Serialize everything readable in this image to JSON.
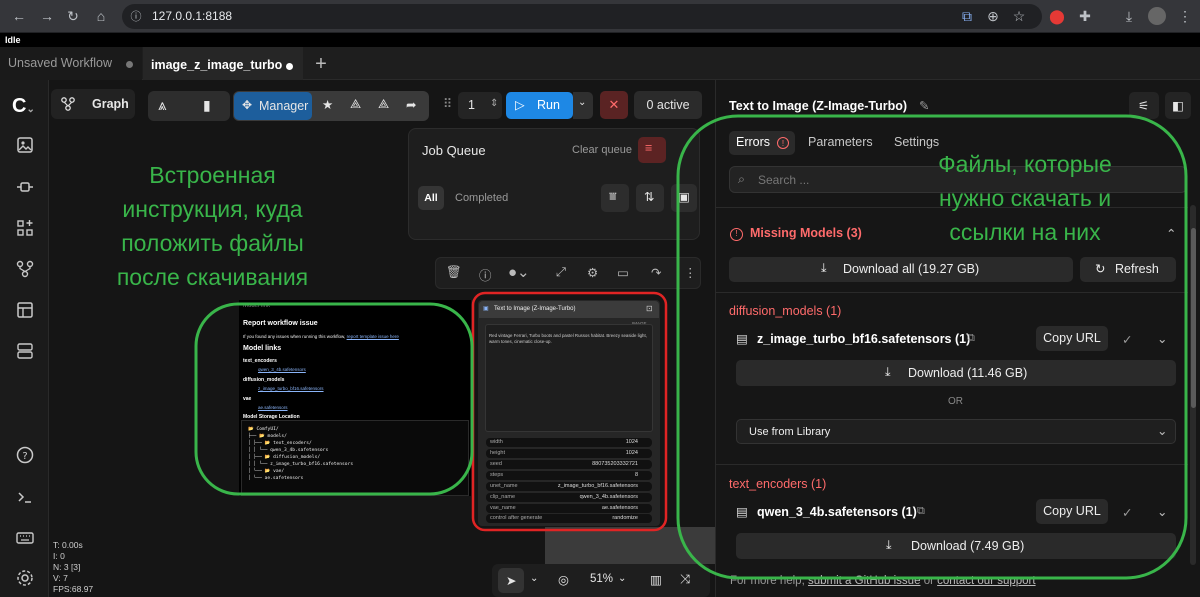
{
  "browser": {
    "url": "127.0.0.1:8188",
    "status": "Idle"
  },
  "tabs": [
    {
      "label": "Unsaved Workflow",
      "active": false
    },
    {
      "label": "image_z_image_turbo",
      "active": true
    }
  ],
  "toolbar": {
    "graph_label": "Graph",
    "manager_label": "Manager",
    "batch_count": "1",
    "run_label": "Run",
    "active_label": "0 active"
  },
  "job_queue": {
    "title": "Job Queue",
    "clear_label": "Clear queue",
    "filter_all": "All",
    "filter_completed": "Completed"
  },
  "annotations": {
    "left": "Встроенная инструкция, куда положить файлы после скачивания",
    "right": "Файлы, которые нужно скачать и ссылки на них"
  },
  "note_node": {
    "header": "Model link",
    "title": "Report workflow issue",
    "intro": "If you found any issues when running this workflow,",
    "intro_link": "report template issue here",
    "links_title": "Model links",
    "text_encoders": "text_encoders",
    "te_file": "qwen_3_4b.safetensors",
    "diffusion_models": "diffusion_models",
    "dm_file": "z_image_turbo_bf16.safetensors",
    "vae": "vae",
    "vae_file": "ae.safetensors",
    "storage_title": "Model Storage Location",
    "tree": [
      "📂 ComfyUI/",
      "├── 📂 models/",
      "│   ├── 📂 text_encoders/",
      "│   │      └── qwen_3_4b.safetensors",
      "│   ├── 📂 diffusion_models/",
      "│   │      └── z_image_turbo_bf16.safetensors",
      "│   └── 📂 vae/",
      "│          └── ae.safetensors"
    ]
  },
  "t2i_node": {
    "title": "Text to Image (Z-Image-Turbo)",
    "prompt": "Red vintage Ferrari, Turbo boots and pastel Russos habitat. Breezy seaside light, warm tones, cinematic close-up.",
    "image_label": "IMAGE",
    "widgets": [
      {
        "name": "width",
        "value": "1024"
      },
      {
        "name": "height",
        "value": "1024"
      },
      {
        "name": "seed",
        "value": "880735203332721"
      },
      {
        "name": "steps",
        "value": "8"
      },
      {
        "name": "unet_name",
        "value": "z_image_turbo_bf16.safetensors"
      },
      {
        "name": "clip_name",
        "value": "qwen_3_4b.safetensors"
      },
      {
        "name": "vae_name",
        "value": "ae.safetensors"
      },
      {
        "name": "control after generate",
        "value": "randomize"
      }
    ]
  },
  "canvas": {
    "zoom": "51%",
    "stats": [
      "T: 0.00s",
      "I: 0",
      "N: 3 [3]",
      "V: 7",
      "FPS:68.97"
    ]
  },
  "panel": {
    "title": "Text to Image (Z-Image-Turbo)",
    "tabs": [
      "Errors",
      "Parameters",
      "Settings"
    ],
    "search_placeholder": "Search ...",
    "missing_label": "Missing Models (3)",
    "download_all": "Download all (19.27 GB)",
    "refresh": "Refresh",
    "sections": [
      {
        "header": "diffusion_models (1)",
        "file": "z_image_turbo_bf16.safetensors (1)",
        "copy": "Copy URL",
        "download": "Download (11.46 GB)"
      },
      {
        "header": "text_encoders (1)",
        "file": "qwen_3_4b.safetensors (1)",
        "copy": "Copy URL",
        "download": "Download (7.49 GB)"
      }
    ],
    "or_label": "OR",
    "use_library": "Use from Library",
    "help_prefix": "For more help,",
    "help_link1": "submit a GitHub issue",
    "help_or": "or",
    "help_link2": "contact our support"
  },
  "colors": {
    "accent": "#1e88e5",
    "manager": "#1d5e9c",
    "error": "#ff6b6b",
    "annotation": "#39b54a",
    "node_outline_red": "#e02424"
  }
}
